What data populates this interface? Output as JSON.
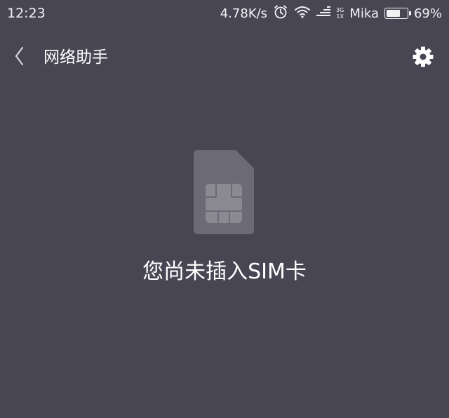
{
  "status_bar": {
    "time": "12:23",
    "speed": "4.78K/s",
    "net_type_top": "3G",
    "net_type_bottom": "1X",
    "carrier": "Mika",
    "battery_percent_label": "69%",
    "battery_level": 0.69
  },
  "toolbar": {
    "title": "网络助手",
    "back_icon": "chevron-left-icon",
    "settings_icon": "gear-icon"
  },
  "main": {
    "sim_icon": "sim-card-icon",
    "message": "您尚未插入SIM卡"
  },
  "colors": {
    "background": "#484653",
    "sim_body": "#6c6a75",
    "sim_chip": "#8b8a93",
    "text": "#ffffff"
  }
}
